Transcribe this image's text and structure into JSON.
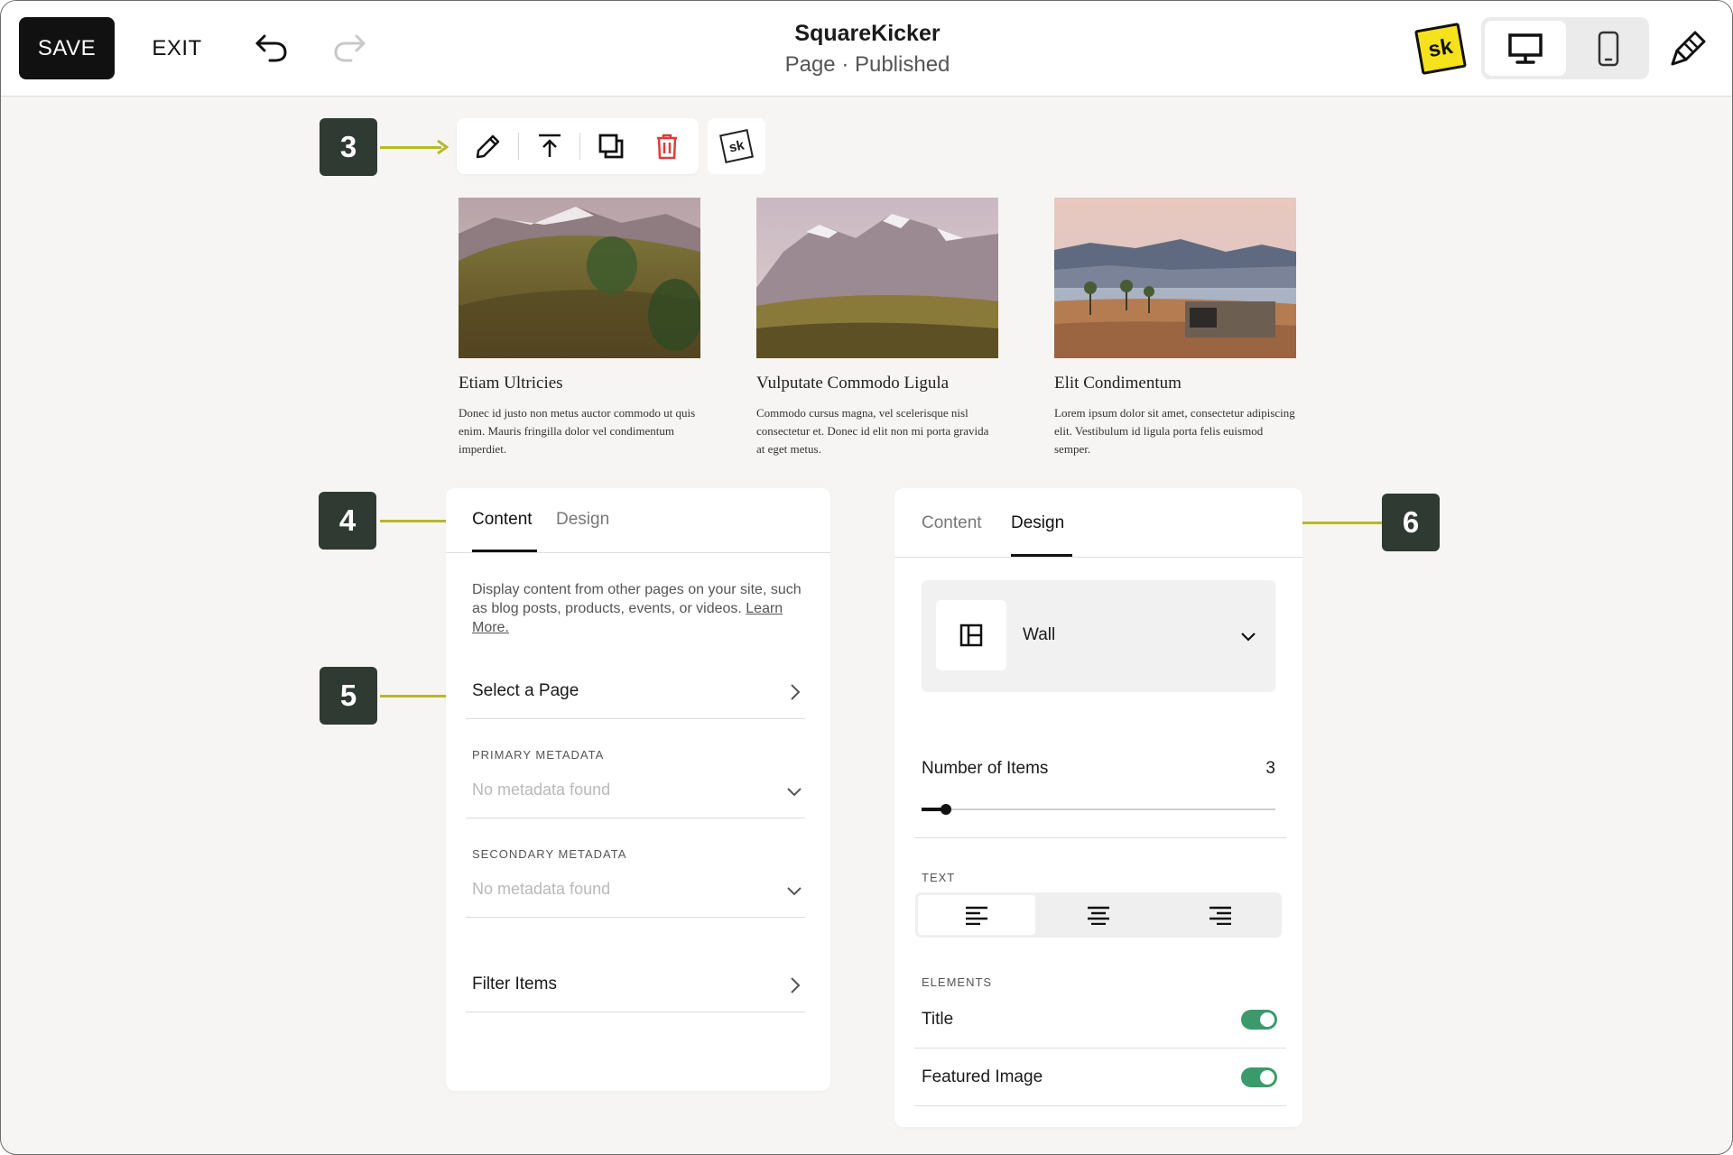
{
  "topbar": {
    "save_label": "SAVE",
    "exit_label": "EXIT",
    "site_name": "SquareKicker",
    "page_status": "Page · Published",
    "sk_badge": "sk",
    "icons": [
      "undo-icon",
      "redo-icon",
      "desktop-icon",
      "mobile-icon",
      "paint-brush-icon"
    ]
  },
  "callouts": [
    "3",
    "4",
    "5",
    "6"
  ],
  "block_toolbar": {
    "icons": [
      "pencil-icon",
      "move-up-icon",
      "duplicate-icon",
      "trash-icon"
    ],
    "sk_label": "sk"
  },
  "cards": [
    {
      "title": "Etiam Ultricies",
      "description": "Donec id justo non metus auctor commodo ut quis enim. Mauris fringilla dolor vel condimentum imperdiet."
    },
    {
      "title": "Vulputate Commodo Ligula",
      "description": "Commodo cursus magna, vel scelerisque nisl consectetur et. Donec id elit non mi porta gravida at eget metus."
    },
    {
      "title": "Elit Condimentum",
      "description": "Lorem ipsum dolor sit amet, consectetur adipiscing elit. Vestibulum id ligula porta felis euismod semper."
    }
  ],
  "content_panel": {
    "tabs": [
      "Content",
      "Design"
    ],
    "active_tab": "Content",
    "description": "Display content from other pages on your site, such as blog posts, products, events, or videos.",
    "learn_more": "Learn More.",
    "select_page": "Select a Page",
    "primary_metadata_label": "PRIMARY METADATA",
    "primary_metadata_value": "No metadata found",
    "secondary_metadata_label": "SECONDARY METADATA",
    "secondary_metadata_value": "No metadata found",
    "filter_items": "Filter Items"
  },
  "design_panel": {
    "tabs": [
      "Content",
      "Design"
    ],
    "active_tab": "Design",
    "layout": "Wall",
    "number_of_items_label": "Number of Items",
    "number_of_items_value": "3",
    "slider_fraction": 0.07,
    "text_section_label": "TEXT",
    "text_alignment_options": [
      "left",
      "center",
      "right"
    ],
    "text_alignment_selected": "left",
    "elements_section_label": "ELEMENTS",
    "elements": [
      {
        "label": "Title",
        "enabled": true
      },
      {
        "label": "Featured Image",
        "enabled": true
      }
    ]
  },
  "colors": {
    "accent_arrow": "#b7b82a",
    "callout_bg": "#2f3a32",
    "toggle_on": "#3a9a6b",
    "delete_red": "#e03a3a",
    "sk_yellow": "#f6e21c"
  }
}
